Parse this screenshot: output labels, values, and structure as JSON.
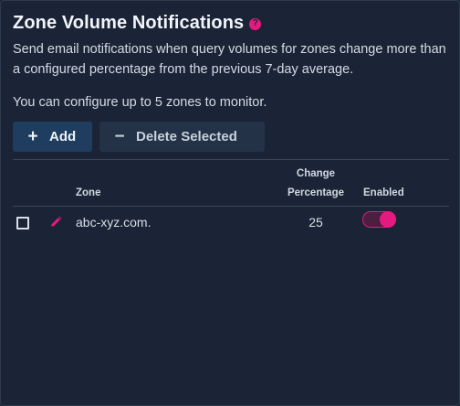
{
  "panel": {
    "title": "Zone Volume Notifications",
    "help_icon": "question-circle-icon",
    "description": "Send email notifications when query volumes for zones change more than a configured percentage from the previous 7-day average.",
    "limit_note": "You can configure up to 5 zones to monitor."
  },
  "toolbar": {
    "add_glyph": "+",
    "add_label": "Add",
    "delete_glyph": "−",
    "delete_label": "Delete Selected"
  },
  "table": {
    "headers": {
      "zone": "Zone",
      "change_line1": "Change",
      "change_line2": "Percentage",
      "enabled": "Enabled"
    },
    "rows": [
      {
        "selected": false,
        "edit_icon": "pencil-icon",
        "zone": "abc-xyz.com.",
        "change_percentage": "25",
        "enabled": true
      }
    ]
  },
  "colors": {
    "accent": "#e6197f",
    "toggle_track": "#4a1f3f",
    "background": "#1b2436"
  }
}
